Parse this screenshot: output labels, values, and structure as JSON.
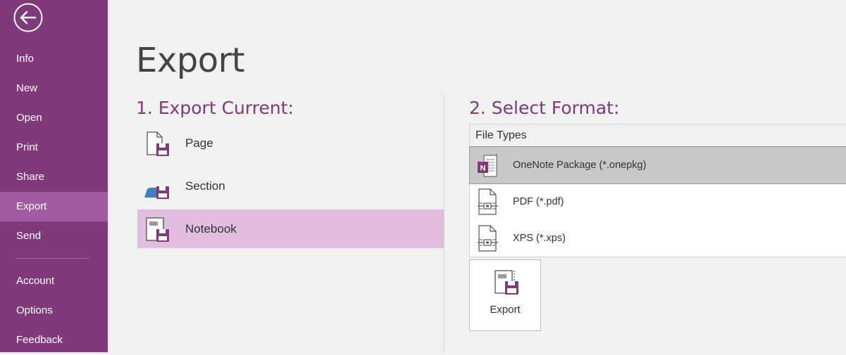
{
  "sidebar": {
    "back_icon": "back-arrow-icon",
    "items": [
      {
        "label": "Info"
      },
      {
        "label": "New"
      },
      {
        "label": "Open"
      },
      {
        "label": "Print"
      },
      {
        "label": "Share"
      },
      {
        "label": "Export",
        "active": true
      },
      {
        "label": "Send"
      },
      {
        "label": "Account"
      },
      {
        "label": "Options"
      },
      {
        "label": "Feedback"
      }
    ]
  },
  "main": {
    "title": "Export",
    "export_current": {
      "heading": "1. Export Current:",
      "items": [
        {
          "label": "Page",
          "icon": "page-save-icon"
        },
        {
          "label": "Section",
          "icon": "section-save-icon"
        },
        {
          "label": "Notebook",
          "icon": "notebook-save-icon",
          "selected": true
        }
      ]
    },
    "select_format": {
      "heading": "2. Select Format:",
      "header": "File Types",
      "items": [
        {
          "label": "OneNote Package (*.onepkg)",
          "icon": "onenote-package-icon",
          "selected": true
        },
        {
          "label": "PDF (*.pdf)",
          "icon": "pdf-file-icon"
        },
        {
          "label": "XPS (*.xps)",
          "icon": "xps-file-icon"
        }
      ]
    },
    "export_button": {
      "label": "Export",
      "icon": "export-save-icon"
    }
  },
  "colors": {
    "accent": "#80397b",
    "sidebar_active": "#a25aa0",
    "selection": "#e1bddf",
    "format_selected": "#c8c8c8"
  }
}
